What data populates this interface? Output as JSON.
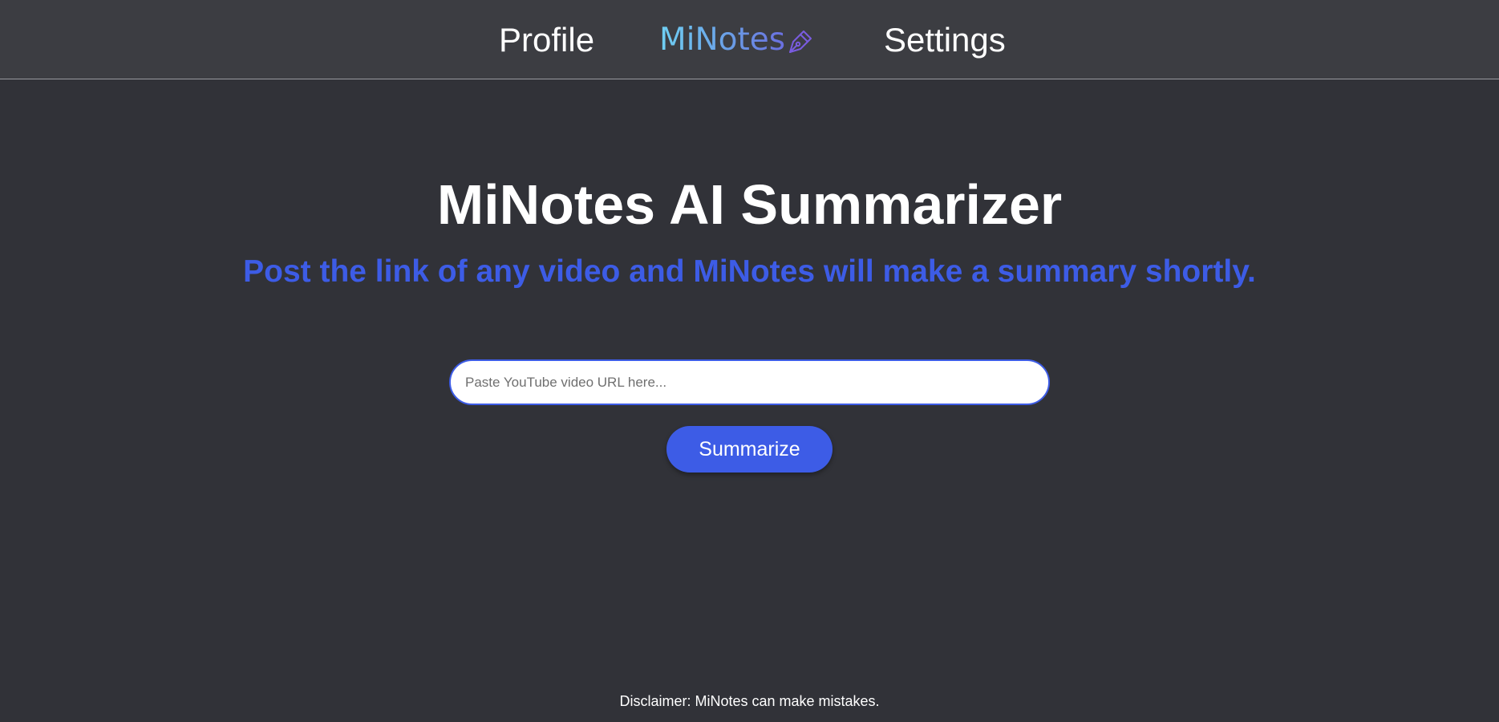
{
  "nav": {
    "profile_label": "Profile",
    "brand_label": "MiNotes",
    "brand_icon": "pen-nib-icon",
    "settings_label": "Settings"
  },
  "main": {
    "title": "MiNotes AI Summarizer",
    "subtitle": "Post the link of any video and MiNotes will make a summary shortly.",
    "url_input": {
      "value": "",
      "placeholder": "Paste YouTube video URL here..."
    },
    "summarize_label": "Summarize"
  },
  "footer": {
    "disclaimer": "Disclaimer: MiNotes can make mistakes."
  },
  "colors": {
    "background": "#313238",
    "nav_background": "#3c3d42",
    "accent": "#3d5ce6",
    "brand_gradient_start": "#6fd0f3",
    "brand_gradient_end": "#6a6ee0",
    "icon": "#7a5ce0"
  }
}
